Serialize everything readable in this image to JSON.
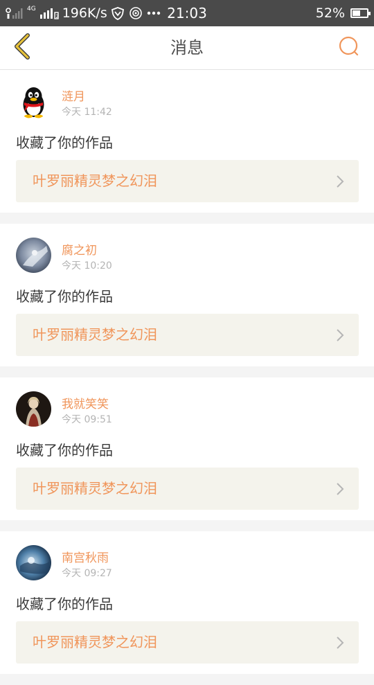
{
  "status_bar": {
    "network_speed": "196K/s",
    "network_type": "4G",
    "time": "21:03",
    "battery_percent": "52%",
    "battery_level": 0.52
  },
  "header": {
    "title": "消息",
    "back_icon": "chevron-left-icon",
    "search_icon": "search-icon",
    "accent_color": "#e7c23a"
  },
  "messages": [
    {
      "user": "涟月",
      "time": "今天 11:42",
      "action": "收藏了你的作品",
      "work_title": "叶罗丽精灵梦之幻泪",
      "avatar": "qq-penguin"
    },
    {
      "user": "腐之初",
      "time": "今天 10:20",
      "action": "收藏了你的作品",
      "work_title": "叶罗丽精灵梦之幻泪",
      "avatar": "grey-figure"
    },
    {
      "user": "我就笑笑",
      "time": "今天 09:51",
      "action": "收藏了你的作品",
      "work_title": "叶罗丽精灵梦之幻泪",
      "avatar": "dark-portrait"
    },
    {
      "user": "南宫秋雨",
      "time": "今天 09:27",
      "action": "收藏了你的作品",
      "work_title": "叶罗丽精灵梦之幻泪",
      "avatar": "blue-sky"
    }
  ],
  "colors": {
    "name": "#f0955a",
    "link_bg": "#f4f3ec",
    "status_bar": "#4a4a4a"
  }
}
